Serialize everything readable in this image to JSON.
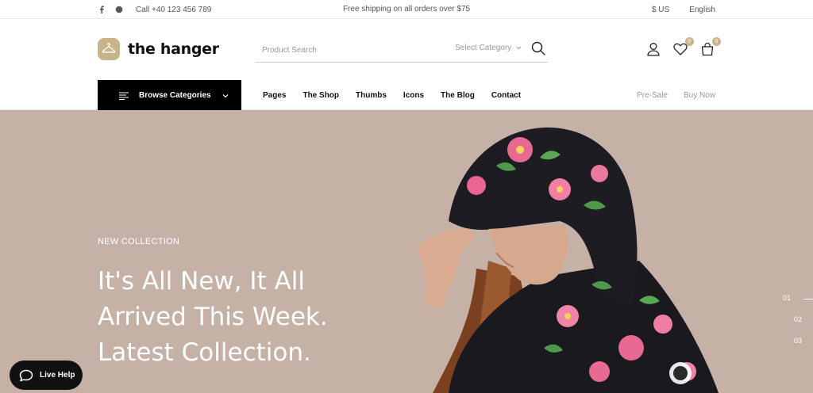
{
  "topbar": {
    "social": [
      {
        "icon": "facebook-icon",
        "glyph": "f"
      },
      {
        "icon": "messenger-icon",
        "glyph": ""
      }
    ],
    "phone": "Call +40 123 456 789",
    "shipping": "Free shipping on all orders over $75",
    "currency": "$ US",
    "language": "English"
  },
  "header": {
    "logo_text": "the hanger",
    "search": {
      "placeholder": "Product Search",
      "category": "Select Category"
    },
    "wishlist_count": "0",
    "cart_count": "0"
  },
  "nav": {
    "browse_label": "Browse Categories",
    "items": [
      "Pages",
      "The Shop",
      "Thumbs",
      "Icons",
      "The Blog",
      "Contact"
    ],
    "right_items": [
      "Pre-Sale",
      "Buy Now"
    ]
  },
  "hero": {
    "subtitle": "NEW COLLECTION",
    "headline": [
      "It's All New, It All",
      "Arrived This Week.",
      "Latest Collection."
    ],
    "slides": [
      "01",
      "02",
      "03"
    ]
  },
  "live_help": "Live Help",
  "colors": {
    "accent": "#c8b48a",
    "hero_bg": "#c6b1a6",
    "dark": "#000000"
  }
}
